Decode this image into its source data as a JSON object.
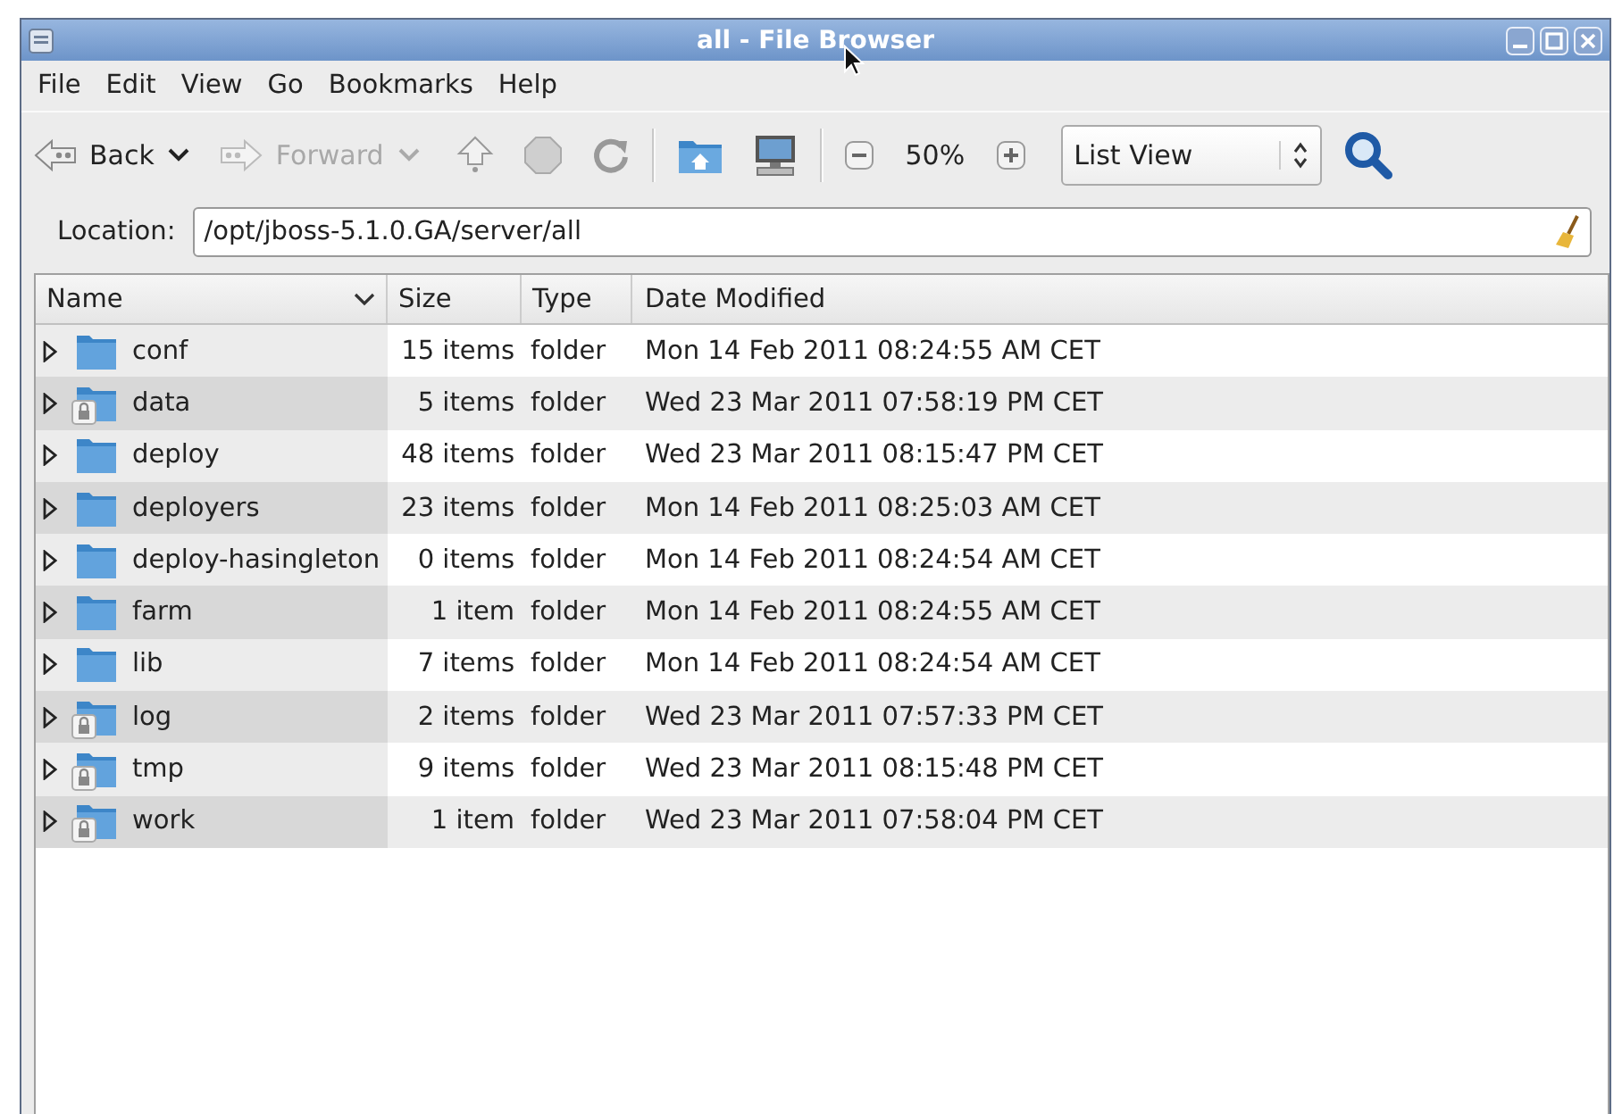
{
  "window": {
    "title": "all - File Browser"
  },
  "menu": [
    "File",
    "Edit",
    "View",
    "Go",
    "Bookmarks",
    "Help"
  ],
  "toolbar": {
    "back": {
      "label": "Back",
      "disabled": false
    },
    "forward": {
      "label": "Forward",
      "disabled": true
    },
    "stop": {
      "disabled": true
    },
    "zoom": "50%",
    "view": "List View"
  },
  "location": {
    "label": "Location:",
    "value": "/opt/jboss-5.1.0.GA/server/all"
  },
  "table": {
    "columns": [
      "Name",
      "Size",
      "Type",
      "Date Modified"
    ],
    "rows": [
      {
        "name": "conf",
        "size": "15 items",
        "type": "folder",
        "date": "Mon 14 Feb 2011 08:24:55 AM CET",
        "locked": false
      },
      {
        "name": "data",
        "size": "5 items",
        "type": "folder",
        "date": "Wed 23 Mar 2011 07:58:19 PM CET",
        "locked": true
      },
      {
        "name": "deploy",
        "size": "48 items",
        "type": "folder",
        "date": "Wed 23 Mar 2011 08:15:47 PM CET",
        "locked": false
      },
      {
        "name": "deployers",
        "size": "23 items",
        "type": "folder",
        "date": "Mon 14 Feb 2011 08:25:03 AM CET",
        "locked": false
      },
      {
        "name": "deploy-hasingleton",
        "size": "0 items",
        "type": "folder",
        "date": "Mon 14 Feb 2011 08:24:54 AM CET",
        "locked": false
      },
      {
        "name": "farm",
        "size": "1 item",
        "type": "folder",
        "date": "Mon 14 Feb 2011 08:24:55 AM CET",
        "locked": false
      },
      {
        "name": "lib",
        "size": "7 items",
        "type": "folder",
        "date": "Mon 14 Feb 2011 08:24:54 AM CET",
        "locked": false
      },
      {
        "name": "log",
        "size": "2 items",
        "type": "folder",
        "date": "Wed 23 Mar 2011 07:57:33 PM CET",
        "locked": true
      },
      {
        "name": "tmp",
        "size": "9 items",
        "type": "folder",
        "date": "Wed 23 Mar 2011 08:15:48 PM CET",
        "locked": true
      },
      {
        "name": "work",
        "size": "1 item",
        "type": "folder",
        "date": "Wed 23 Mar 2011 07:58:04 PM CET",
        "locked": true
      }
    ]
  }
}
